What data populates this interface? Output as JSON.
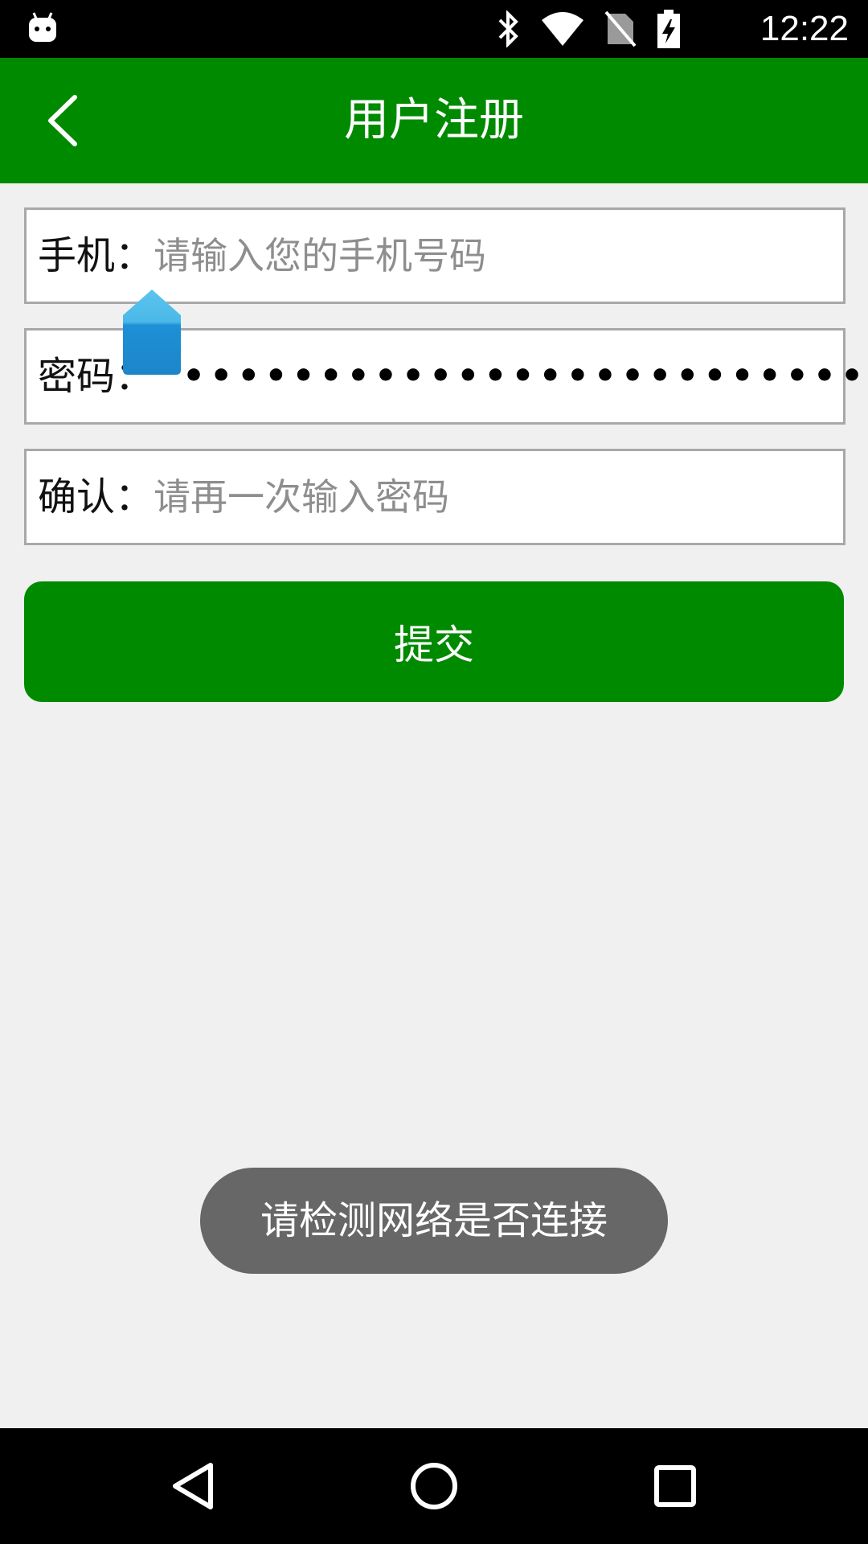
{
  "status_bar": {
    "time": "12:22",
    "icons": [
      "android-robot-icon",
      "bluetooth-icon",
      "wifi-icon",
      "no-sim-icon",
      "battery-charging-icon"
    ]
  },
  "app_bar": {
    "title": "用户注册",
    "back_icon": "chevron-left-icon"
  },
  "form": {
    "phone": {
      "label": "手机：",
      "placeholder": "请输入您的手机号码",
      "value": ""
    },
    "password": {
      "label": "密码：",
      "masked_value": "•••••••••••••••••••••••••"
    },
    "confirm": {
      "label": "确认：",
      "placeholder": "请再一次输入密码",
      "value": ""
    },
    "submit_label": "提交"
  },
  "toast": {
    "message": "请检测网络是否连接"
  },
  "nav_bar": {
    "icons": [
      "nav-back-icon",
      "nav-home-icon",
      "nav-recents-icon"
    ]
  },
  "colors": {
    "primary": "#008a00",
    "background": "#f0f0f0",
    "toast_bg": "#676767",
    "cursor_handle": "#1e90d6"
  }
}
